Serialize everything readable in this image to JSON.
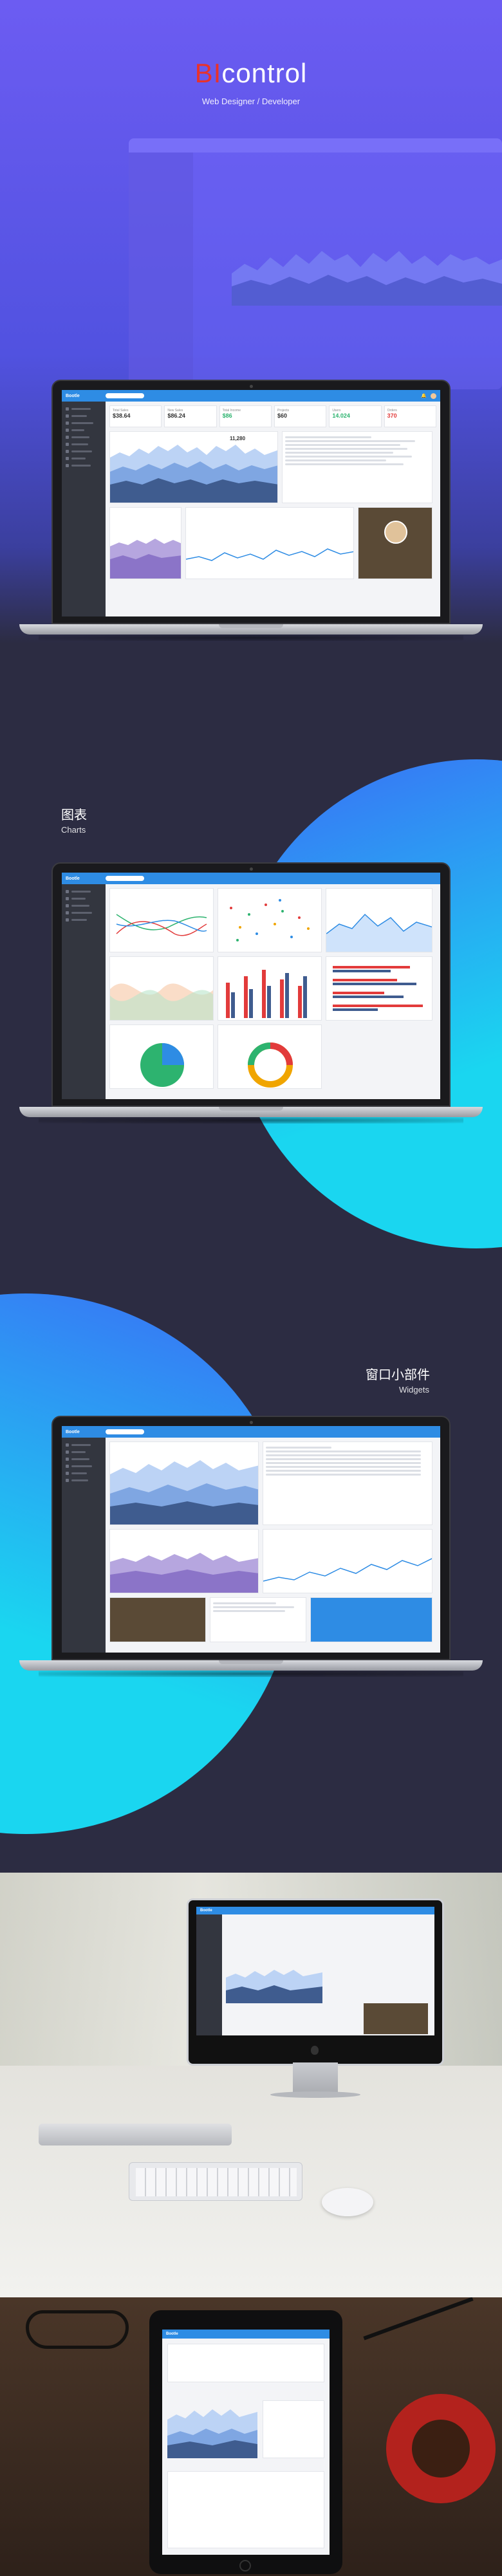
{
  "hero": {
    "title_prefix": "BI",
    "title_rest": "control",
    "subtitle": "Web Designer / Developer"
  },
  "sections": {
    "charts_cn": "图表",
    "charts_en": "Charts",
    "widgets_cn": "窗口小部件",
    "widgets_en": "Widgets"
  },
  "dashboard": {
    "brand": "Bootle",
    "stats": [
      {
        "label": "Total Sales",
        "value": "$38.64",
        "delta": "",
        "color": "#333333"
      },
      {
        "label": "New Sales",
        "value": "$86.24",
        "delta": "",
        "color": "#333333"
      },
      {
        "label": "Total Income",
        "value": "$86",
        "delta": "",
        "color": "#2db36f"
      },
      {
        "label": "Projects",
        "value": "$60",
        "delta": "",
        "color": "#333333"
      },
      {
        "label": "Users",
        "value": "14.024",
        "delta": "",
        "color": "#2db36f"
      },
      {
        "label": "Orders",
        "value": "370",
        "delta": "",
        "color": "#e23b3b"
      }
    ],
    "visits_value": "11,280"
  },
  "colors": {
    "hero_top": "#6a5bf0",
    "hero_bottom": "#4250d8",
    "dark_bg": "#2c2c42",
    "cyan": "#1ad6f0",
    "blue": "#2e8ce4",
    "accent_red": "#e8322b"
  }
}
